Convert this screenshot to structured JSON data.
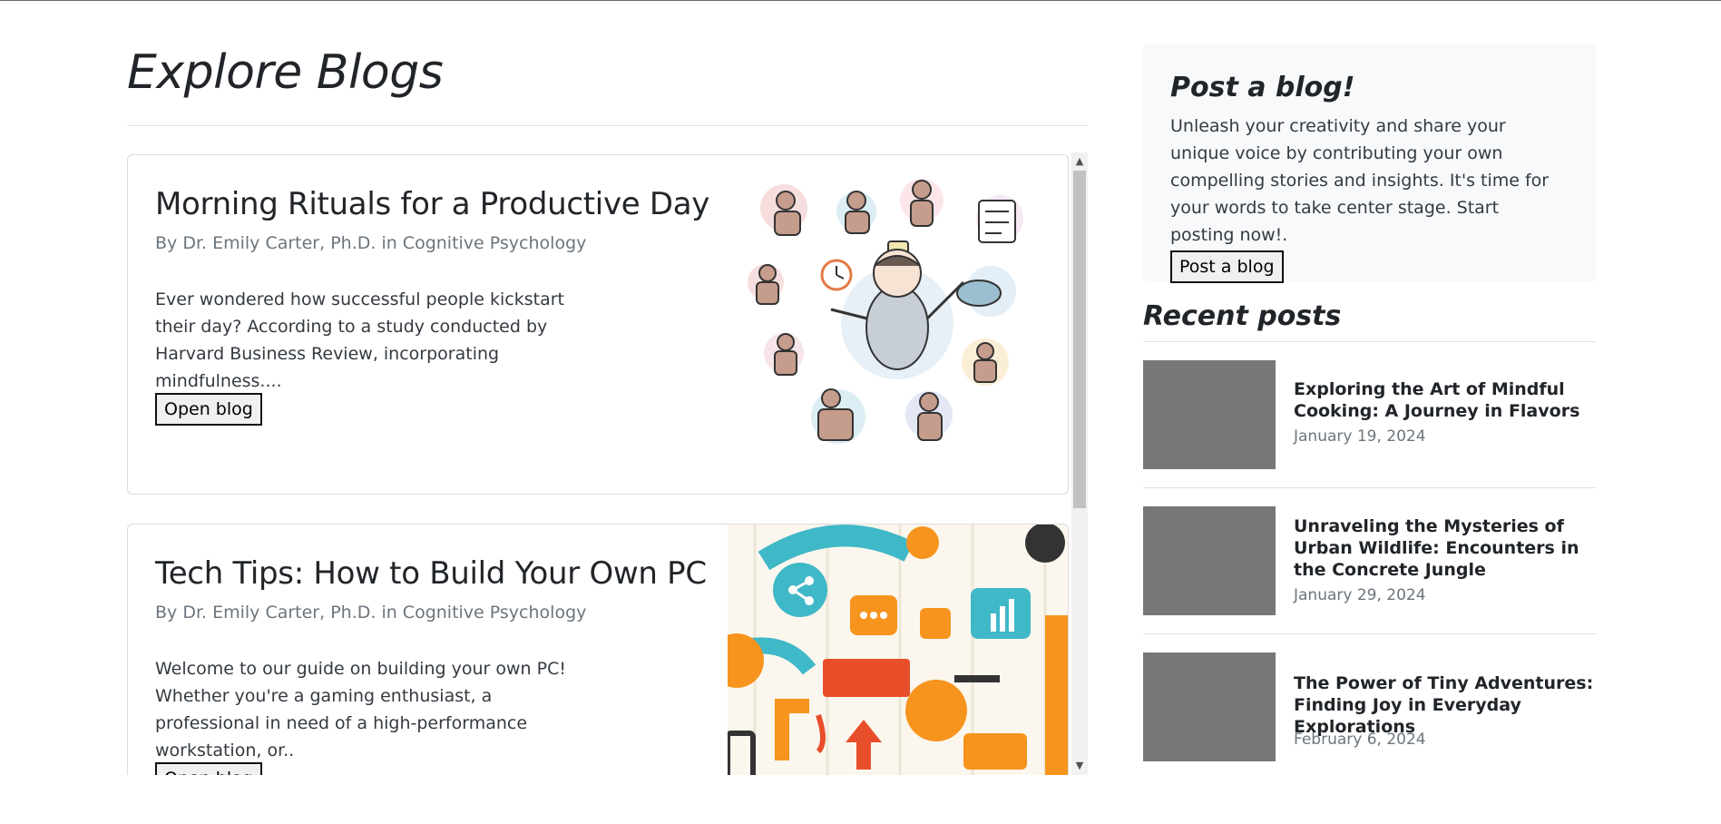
{
  "page": {
    "title": "Explore Blogs"
  },
  "blogs": [
    {
      "title": "Morning Rituals for a Productive Day",
      "meta": "By Dr. Emily Carter, Ph.D. in Cognitive Psychology",
      "excerpt": "Ever wondered how successful people kickstart their day? According to a study conducted by Harvard Business Review, incorporating mindfulness....",
      "button": "Open blog",
      "image_icon": "morning-routine-illustration"
    },
    {
      "title": "Tech Tips: How to Build Your Own PC",
      "meta": "By Dr. Emily Carter, Ph.D. in Cognitive Psychology",
      "excerpt": "Welcome to our guide on building your own PC! Whether you're a gaming enthusiast, a professional in need of a high-performance workstation, or..",
      "button": "Open blog",
      "image_icon": "tech-icons-pattern"
    }
  ],
  "post_box": {
    "heading": "Post a blog!",
    "text": "Unleash your creativity and share your unique voice by contributing your own compelling stories and insights. It's time for your words to take center stage. Start posting now!.",
    "button": "Post a blog"
  },
  "recent": {
    "heading": "Recent posts",
    "items": [
      {
        "title": "Exploring the Art of Mindful Cooking: A Journey in Flavors",
        "date": "January 19, 2024"
      },
      {
        "title": "Unraveling the Mysteries of Urban Wildlife: Encounters in the Concrete Jungle",
        "date": "January 29, 2024"
      },
      {
        "title": "The Power of Tiny Adventures: Finding Joy in Everyday Explorations",
        "date": "February 6, 2024"
      }
    ]
  },
  "colors": {
    "accent_teal": "#3fb8c8",
    "accent_orange": "#f7941d",
    "thumb_gray": "#777777",
    "sidebar_bg": "#f8f9fa"
  }
}
